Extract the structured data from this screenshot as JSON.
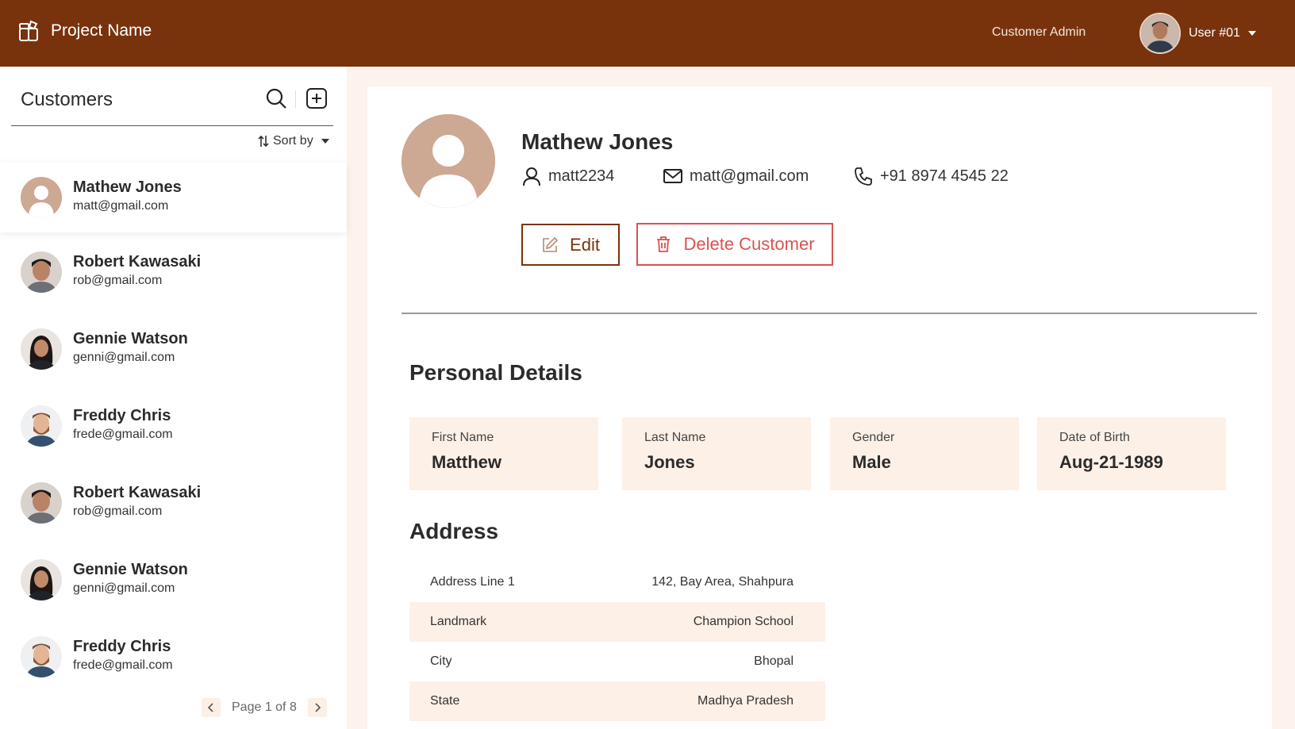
{
  "app": {
    "project_name": "Project Name"
  },
  "header": {
    "role": "Customer Admin",
    "user": "User #01"
  },
  "sidebar": {
    "title": "Customers",
    "sort_label": "Sort by",
    "customers": [
      {
        "name": "Mathew Jones",
        "email": "matt@gmail.com",
        "avatar": "placeholder",
        "active": true
      },
      {
        "name": "Robert Kawasaki",
        "email": "rob@gmail.com",
        "avatar": "man-dark-hair"
      },
      {
        "name": "Gennie Watson",
        "email": "genni@gmail.com",
        "avatar": "woman-dark-hair"
      },
      {
        "name": "Freddy Chris",
        "email": "frede@gmail.com",
        "avatar": "man-beard"
      },
      {
        "name": "Robert Kawasaki",
        "email": "rob@gmail.com",
        "avatar": "man-dark-hair"
      },
      {
        "name": "Gennie Watson",
        "email": "genni@gmail.com",
        "avatar": "woman-dark-hair"
      },
      {
        "name": "Freddy Chris",
        "email": "frede@gmail.com",
        "avatar": "man-beard"
      }
    ],
    "pager": {
      "text": "Page 1 of 8"
    }
  },
  "profile": {
    "name": "Mathew Jones",
    "username": "matt2234",
    "email": "matt@gmail.com",
    "phone": "+91 8974 4545 22",
    "edit_label": "Edit",
    "delete_label": "Delete Customer"
  },
  "personal": {
    "title": "Personal Details",
    "fields": [
      {
        "label": "First Name",
        "value": "Matthew"
      },
      {
        "label": "Last Name",
        "value": "Jones"
      },
      {
        "label": "Gender",
        "value": "Male"
      },
      {
        "label": "Date of Birth",
        "value": "Aug-21-1989"
      }
    ]
  },
  "address": {
    "title": "Address",
    "rows": [
      {
        "label": "Address Line 1",
        "value": "142, Bay Area, Shahpura"
      },
      {
        "label": "Landmark",
        "value": "Champion School"
      },
      {
        "label": "City",
        "value": "Bhopal"
      },
      {
        "label": "State",
        "value": "Madhya Pradesh"
      }
    ]
  },
  "colors": {
    "header": "#78330d",
    "accent_bg": "#fdf0e7",
    "danger": "#d9534f",
    "avatar_placeholder": "#cda893"
  }
}
